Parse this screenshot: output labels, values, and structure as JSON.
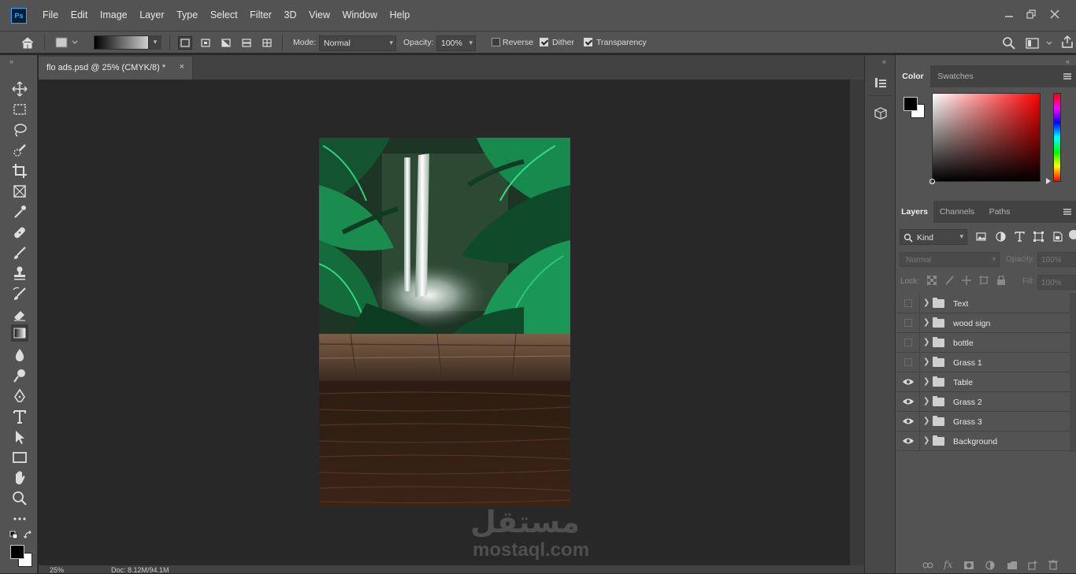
{
  "app": {
    "logo": "Ps"
  },
  "menu": {
    "items": [
      "File",
      "Edit",
      "Image",
      "Layer",
      "Type",
      "Select",
      "Filter",
      "3D",
      "View",
      "Window",
      "Help"
    ]
  },
  "options": {
    "mode_label": "Mode:",
    "mode_value": "Normal",
    "opacity_label": "Opacity:",
    "opacity_value": "100%",
    "reverse_label": "Reverse",
    "reverse_checked": false,
    "dither_label": "Dither",
    "dither_checked": true,
    "transparency_label": "Transparency",
    "transparency_checked": true
  },
  "document": {
    "tab_title": "flo ads.psd @ 25% (CMYK/8) *",
    "close_glyph": "×",
    "zoom": "25%",
    "doc_info": "Doc: 8.12M/94.1M"
  },
  "color_panel": {
    "tabs": [
      "Color",
      "Swatches"
    ],
    "active_tab": "Color",
    "foreground": "#000000",
    "background": "#ffffff"
  },
  "layers_panel": {
    "tabs": [
      "Layers",
      "Channels",
      "Paths"
    ],
    "active_tab": "Layers",
    "filter_label": "Kind",
    "blend_mode": "Normal",
    "opacity_label": "Opacity:",
    "opacity_value": "100%",
    "lock_label": "Lock:",
    "fill_label": "Fill:",
    "fill_value": "100%",
    "layers": [
      {
        "name": "Text",
        "visible": false
      },
      {
        "name": "wood sign",
        "visible": false
      },
      {
        "name": "bottle",
        "visible": false
      },
      {
        "name": "Grass 1",
        "visible": false
      },
      {
        "name": "Table",
        "visible": true
      },
      {
        "name": "Grass 2",
        "visible": true
      },
      {
        "name": "Grass 3",
        "visible": true
      },
      {
        "name": "Background",
        "visible": true
      }
    ]
  },
  "watermark": {
    "arabic": "مستقل",
    "latin": "mostaql.com"
  }
}
